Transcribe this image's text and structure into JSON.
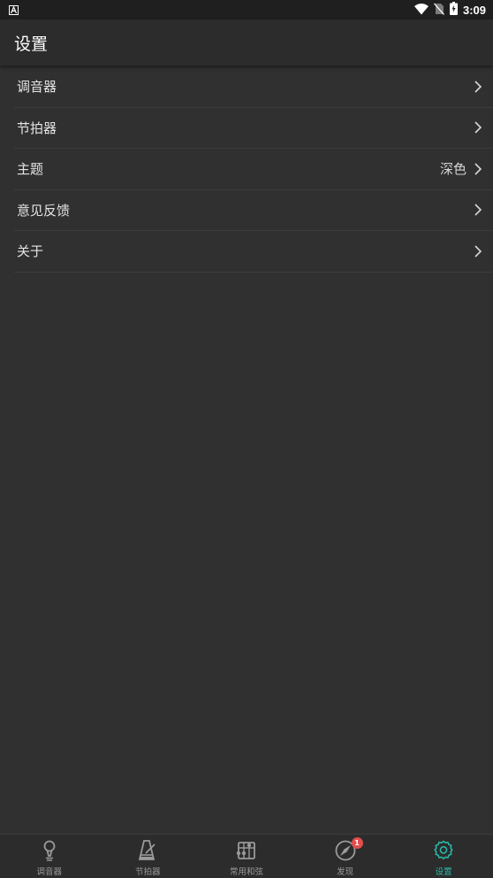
{
  "status_bar": {
    "time": "3:09",
    "left_icon": "notification-a-icon",
    "icons": [
      "wifi-icon",
      "no-sim-icon",
      "battery-charging-icon"
    ]
  },
  "app_bar": {
    "title": "设置"
  },
  "settings": {
    "items": [
      {
        "label": "调音器",
        "value": ""
      },
      {
        "label": "节拍器",
        "value": ""
      },
      {
        "label": "主题",
        "value": "深色"
      },
      {
        "label": "意见反馈",
        "value": ""
      },
      {
        "label": "关于",
        "value": ""
      }
    ]
  },
  "bottom_nav": {
    "items": [
      {
        "label": "调音器",
        "icon": "tuner-icon",
        "active": false
      },
      {
        "label": "节拍器",
        "icon": "metronome-icon",
        "active": false
      },
      {
        "label": "常用和弦",
        "icon": "chord-icon",
        "active": false
      },
      {
        "label": "发现",
        "icon": "compass-icon",
        "active": false,
        "badge": "1"
      },
      {
        "label": "设置",
        "icon": "gear-icon",
        "active": true
      }
    ]
  },
  "colors": {
    "background": "#303030",
    "app_bar": "#2c2c2c",
    "accent": "#2ab7a6",
    "badge": "#e24d4d",
    "inactive_icon": "#9a9a9a"
  }
}
